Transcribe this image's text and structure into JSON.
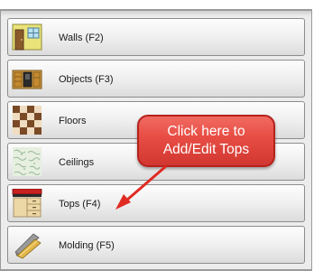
{
  "menu": {
    "items": [
      {
        "label": "Walls (F2)",
        "icon": "walls-icon"
      },
      {
        "label": "Objects (F3)",
        "icon": "objects-icon"
      },
      {
        "label": "Floors",
        "icon": "floors-icon"
      },
      {
        "label": "Ceilings",
        "icon": "ceilings-icon"
      },
      {
        "label": "Tops (F4)",
        "icon": "tops-icon"
      },
      {
        "label": "Molding (F5)",
        "icon": "molding-icon"
      }
    ]
  },
  "callout": {
    "line1": "Click here to",
    "line2": "Add/Edit Tops",
    "color": "#e84e45"
  }
}
